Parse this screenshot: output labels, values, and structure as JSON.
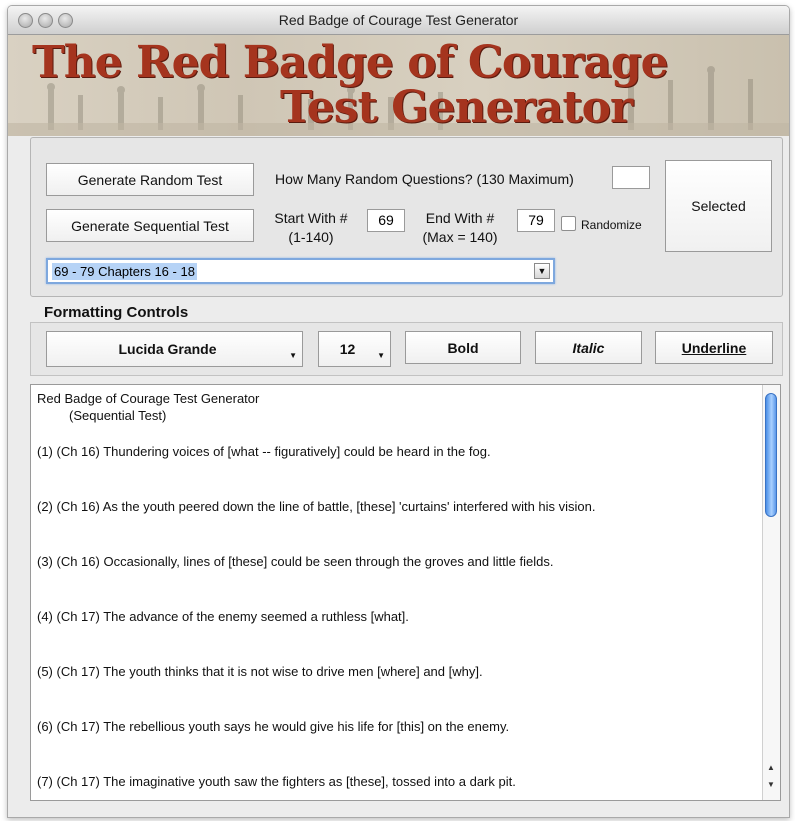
{
  "window": {
    "title": "Red Badge of Courage Test Generator"
  },
  "banner": {
    "line1": "The Red Badge of Courage",
    "line2": "Test Generator"
  },
  "controls": {
    "random_button": "Generate Random Test",
    "random_question_label": "How Many Random Questions? (130 Maximum)",
    "random_count_value": "",
    "selected_button": "Selected",
    "sequential_button": "Generate Sequential Test",
    "start_label_1": "Start With #",
    "start_label_2": "(1-140)",
    "start_value": "69",
    "end_label_1": "End With #",
    "end_label_2": "(Max = 140)",
    "end_value": "79",
    "randomize_label": "Randomize",
    "randomize_checked": false,
    "range_select_value": "69 - 79 Chapters 16 - 18"
  },
  "formatting": {
    "heading": "Formatting Controls",
    "font": "Lucida Grande",
    "size": "12",
    "bold": "Bold",
    "italic": "Italic",
    "underline": "Underline"
  },
  "document": {
    "title": "Red Badge of Courage Test Generator",
    "subtitle": "(Sequential Test)",
    "questions": [
      "(1)  (Ch 16)  Thundering voices of [what -- figuratively] could be heard in the fog.",
      "(2)  (Ch 16)  As the youth peered down the line of battle, [these] 'curtains' interfered with his vision.",
      "(3)  (Ch 16)  Occasionally, lines of [these] could be seen through the groves and little fields.",
      "(4)  (Ch 17)  The advance of the enemy seemed a ruthless [what].",
      "(5)  (Ch 17)  The youth thinks that it is not wise to drive men [where] and [why].",
      "(6)  (Ch 17)  The rebellious youth says he would give his life for [this] on the enemy.",
      "(7)  (Ch 17)  The imaginative youth saw the fighters as [these], tossed into a dark pit."
    ]
  },
  "icons": {
    "close": "close-traffic-light-icon",
    "minimize": "minimize-traffic-light-icon",
    "zoom": "zoom-traffic-light-icon",
    "dropdown": "chevron-down-icon",
    "scroll_up": "scroll-up-arrow-icon",
    "scroll_down": "scroll-down-arrow-icon"
  }
}
